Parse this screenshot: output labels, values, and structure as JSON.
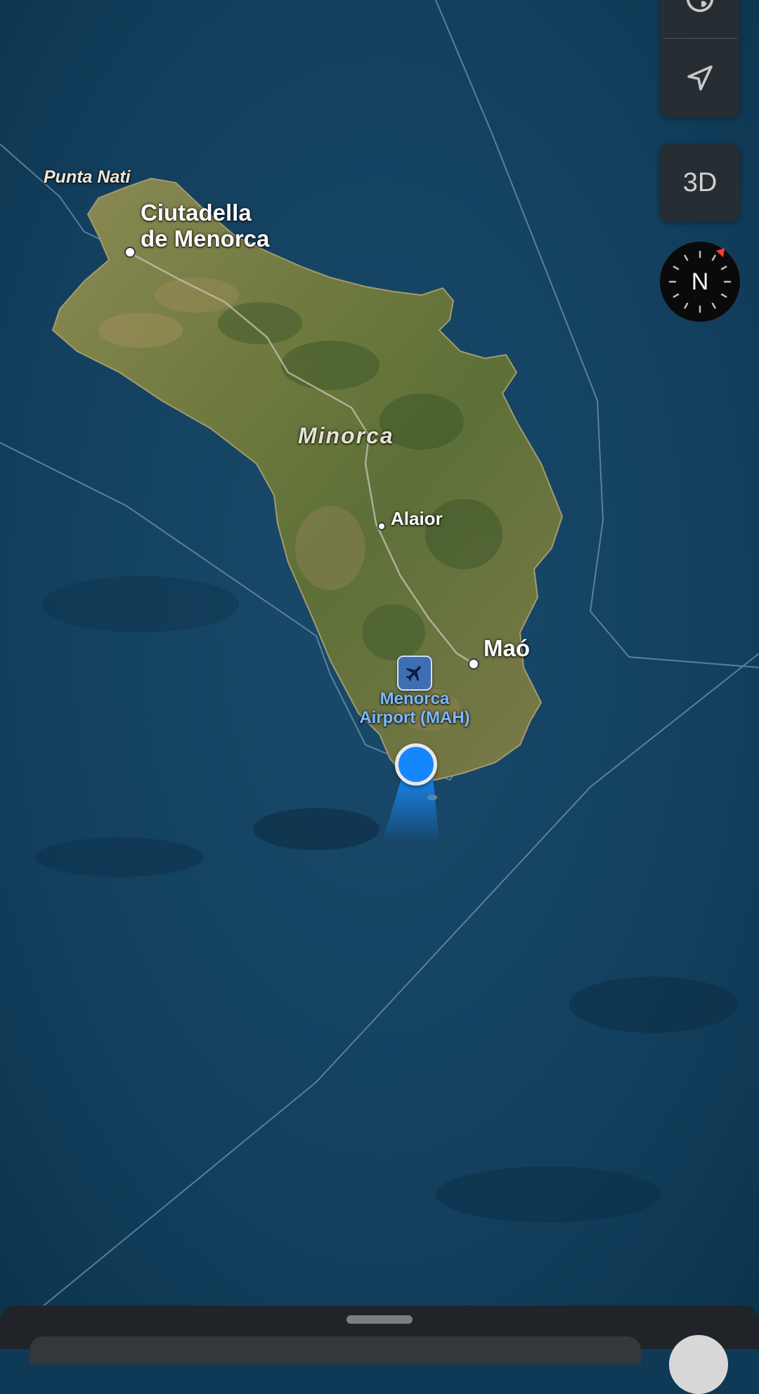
{
  "map": {
    "style": "satellite",
    "labels": {
      "punta_nati": "Punta Nati",
      "ciutadella_line1": "Ciutadella",
      "ciutadella_line2": "de Menorca",
      "island": "Minorca",
      "alaior": "Alaior",
      "mao": "Maó",
      "airport_line1": "Menorca",
      "airport_line2": "Airport (MAH)"
    },
    "icons": {
      "airport": "airplane-icon",
      "user_location": "user-location-icon"
    }
  },
  "controls": {
    "globe_icon": "globe-icon",
    "locate_icon": "location-arrow-icon",
    "three_d_label": "3D",
    "compass_label": "N"
  },
  "colors": {
    "ocean": "#0f3a57",
    "user_location": "#1686ff",
    "poi_label": "#7ab9ff",
    "compass_north": "#ff3b30"
  }
}
